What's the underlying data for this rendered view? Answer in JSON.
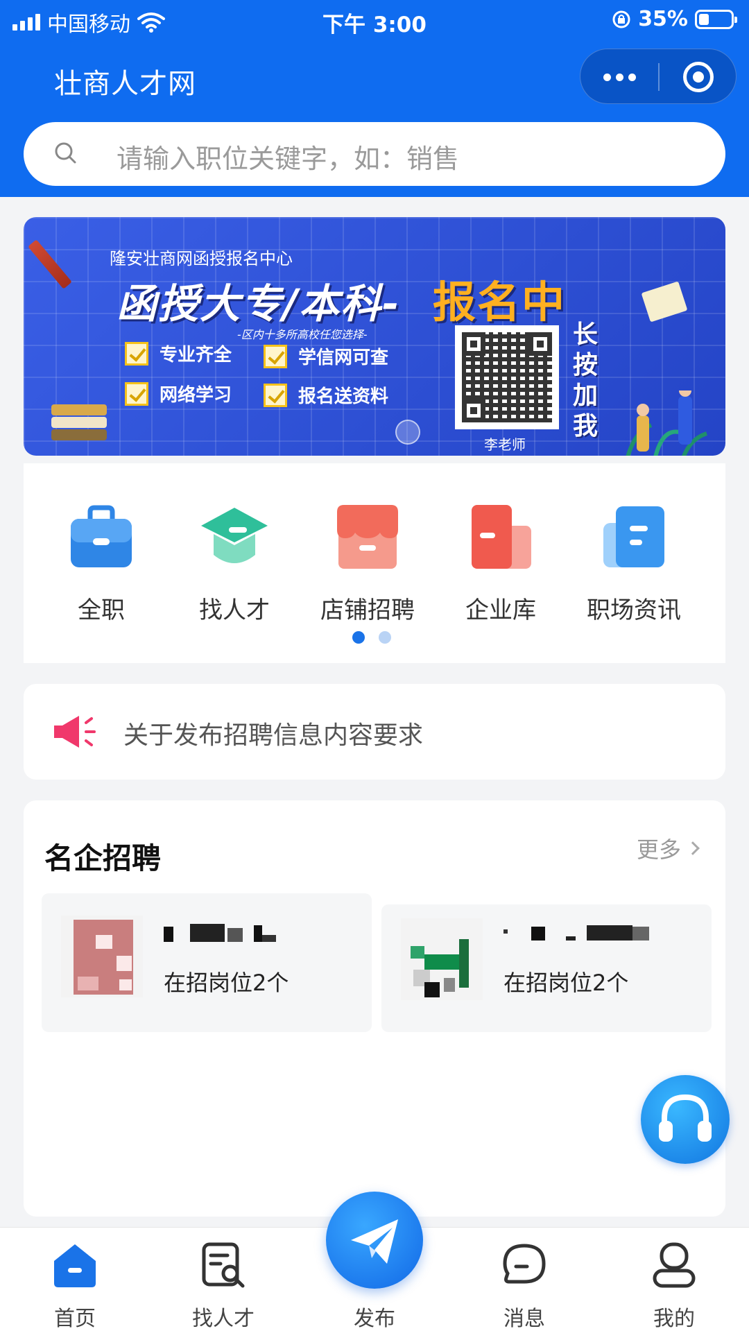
{
  "status_bar": {
    "carrier": "中国移动",
    "time": "下午 3:00",
    "battery": "35%"
  },
  "header": {
    "app_title": "壮商人才网",
    "search_placeholder": "请输入职位关键字，如：销售"
  },
  "banner": {
    "subtitle": "隆安壮商网函授报名中心",
    "title_main": "函授大专/本科-",
    "title_highlight": "报名中",
    "note": "-区内十多所高校任您选择-",
    "features": [
      "专业齐全",
      "学信网可查",
      "网络学习",
      "报名送资料"
    ],
    "press_hint": "长按加我",
    "qr_caption": "李老师"
  },
  "categories": {
    "items": [
      {
        "label": "全职",
        "icon": "briefcase-icon",
        "color": "#2f86e6"
      },
      {
        "label": "找人才",
        "icon": "graduation-cap-icon",
        "color": "#2fbf9a"
      },
      {
        "label": "店铺招聘",
        "icon": "store-icon",
        "color": "#f26b5b"
      },
      {
        "label": "企业库",
        "icon": "building-icon",
        "color": "#f05a4e"
      },
      {
        "label": "职场资讯",
        "icon": "news-icon",
        "color": "#3a97f0"
      }
    ],
    "page_dots": 2,
    "active_dot": 0
  },
  "notice": {
    "text": "关于发布招聘信息内容要求",
    "icon": "megaphone-icon"
  },
  "companies": {
    "title": "名企招聘",
    "more": "更多",
    "items": [
      {
        "name": "",
        "jobs": "在招岗位2个"
      },
      {
        "name": "",
        "jobs": "在招岗位2个"
      }
    ]
  },
  "tabbar": {
    "items": [
      {
        "label": "首页",
        "icon": "home-icon",
        "active": true
      },
      {
        "label": "找人才",
        "icon": "talent-search-icon",
        "active": false
      },
      {
        "label": "发布",
        "icon": "paper-plane-icon",
        "active": false
      },
      {
        "label": "消息",
        "icon": "message-icon",
        "active": false
      },
      {
        "label": "我的",
        "icon": "user-icon",
        "active": false
      }
    ]
  },
  "colors": {
    "primary": "#0f6cf0",
    "page_bg": "#f3f4f6",
    "notice_icon": "#f0386b",
    "banner_highlight": "#ffb020"
  }
}
